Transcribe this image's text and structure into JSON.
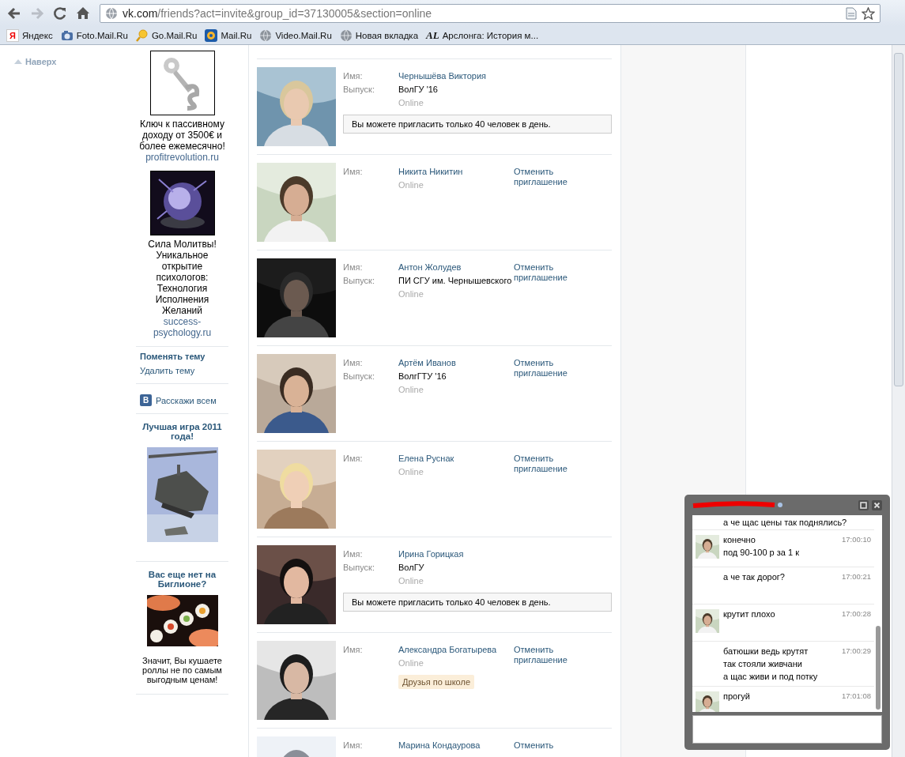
{
  "browser": {
    "url_host": "vk.com",
    "url_path": "/friends?act=invite&group_id=37130005&section=online",
    "forward_disabled": true,
    "bookmarks": [
      {
        "kind": "yandex",
        "icon_text": "Я",
        "label": "Яндекс"
      },
      {
        "kind": "camera",
        "label": "Foto.Mail.Ru"
      },
      {
        "kind": "search",
        "label": "Go.Mail.Ru"
      },
      {
        "kind": "at",
        "label": "Mail.Ru"
      },
      {
        "kind": "globe",
        "label": "Video.Mail.Ru"
      },
      {
        "kind": "globe",
        "label": "Новая вкладка"
      },
      {
        "kind": "letters",
        "icon_text": "AL",
        "label": "Арслонга: История м..."
      }
    ]
  },
  "back_to_top": "Наверх",
  "sidebar": [
    {
      "kind": "ad",
      "text": "Ключ к пассивному доходу от 3500€ и более ежемесячно!",
      "link": "profitrevolution.ru"
    },
    {
      "kind": "ad",
      "text": "Сила Молитвы! Уникальное открытие психологов: Технология Исполнения Желаний",
      "link": "success-psychology.ru"
    },
    {
      "kind": "links",
      "items": [
        {
          "label": "Поменять тему",
          "bold": true
        },
        {
          "label": "Удалить тему",
          "bold": false
        }
      ]
    },
    {
      "kind": "share",
      "label": "Расскажи всем",
      "icon_text": "B"
    },
    {
      "kind": "promo",
      "title": "Лучшая игра 2011 года!"
    },
    {
      "kind": "promo",
      "title": "Вас еще нет на Биглионе?",
      "text": "Значит, Вы кушаете роллы не по самым выгодным ценам!"
    }
  ],
  "friends": [
    {
      "name_label": "Имя:",
      "name": "Чернышёва Виктория",
      "grad_label": "Выпуск:",
      "grad": "ВолГУ '16",
      "status": "Online",
      "notice": "Вы можете пригласить только 40 человек в день."
    },
    {
      "name_label": "Имя:",
      "name": "Никита Никитин",
      "status": "Online",
      "cancel": "Отменить приглашение"
    },
    {
      "name_label": "Имя:",
      "name": "Антон Жолудев",
      "grad_label": "Выпуск:",
      "grad": "ПИ СГУ им. Чернышевского",
      "status": "Online",
      "cancel": "Отменить приглашение"
    },
    {
      "name_label": "Имя:",
      "name": "Артём Иванов",
      "grad_label": "Выпуск:",
      "grad": "ВолгГТУ '16",
      "status": "Online",
      "cancel": "Отменить приглашение"
    },
    {
      "name_label": "Имя:",
      "name": "Елена Руснак",
      "status": "Online",
      "cancel": "Отменить приглашение"
    },
    {
      "name_label": "Имя:",
      "name": "Ирина Горицкая",
      "grad_label": "Выпуск:",
      "grad": "ВолГУ",
      "status": "Online",
      "notice": "Вы можете пригласить только 40 человек в день."
    },
    {
      "name_label": "Имя:",
      "name": "Александра Богатырева",
      "status": "Online",
      "cancel": "Отменить приглашение",
      "tag": "Друзья по школе"
    },
    {
      "name_label": "Имя:",
      "name": "Марина Кондаурова",
      "cancel": "Отменить"
    }
  ],
  "chat": {
    "messages": [
      {
        "from_contact": false,
        "lines": [
          "а че щас цены так поднялись?"
        ]
      },
      {
        "from_contact": true,
        "lines": [
          "конечно",
          "под 90-100 р за 1 к"
        ],
        "time": "17:00:10"
      },
      {
        "from_contact": false,
        "lines": [
          "а че так дорог?"
        ],
        "time": "17:00:21"
      },
      {
        "from_contact": true,
        "lines": [
          "крутит плохо"
        ],
        "time": "17:00:28"
      },
      {
        "from_contact": false,
        "lines": [
          "батюшки ведь крутят",
          "так стояли живчани",
          "а щас живи и под потку"
        ],
        "time": "17:00:29"
      },
      {
        "from_contact": true,
        "lines": [
          "прогуй"
        ],
        "time": "17:01:08"
      }
    ]
  }
}
